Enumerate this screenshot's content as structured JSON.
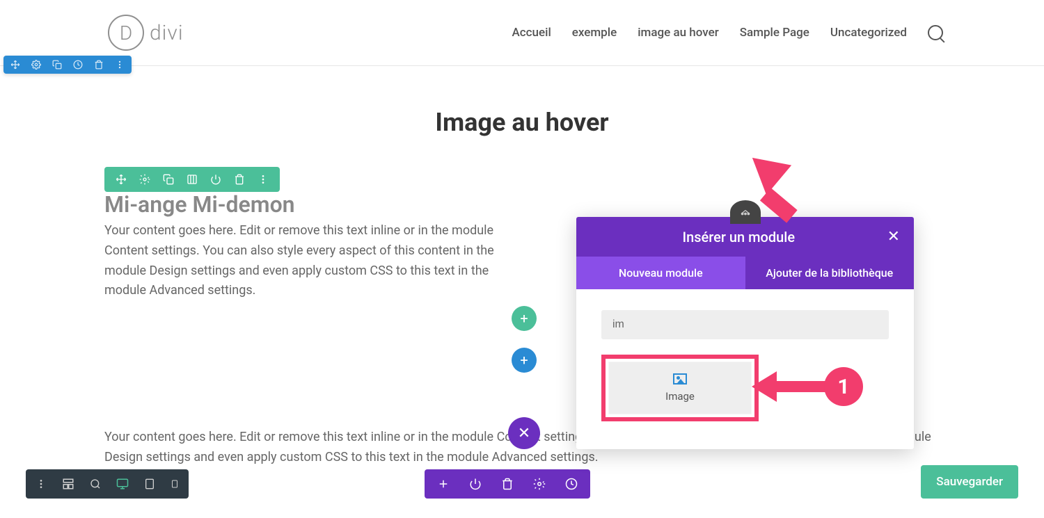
{
  "header": {
    "logo_text": "divi",
    "logo_letter": "D",
    "nav": [
      "Accueil",
      "exemple",
      "image au hover",
      "Sample Page",
      "Uncategorized"
    ]
  },
  "page": {
    "title": "Image au hover",
    "section_heading": "Mi-ange Mi-demon",
    "body1": "Your content goes here. Edit or remove this text inline or in the module Content settings. You can also style every aspect of this content in the module Design settings and even apply custom CSS to this text in the module Advanced settings.",
    "body2": "Your content goes here. Edit or remove this text inline or in the module Content settings. You can also style every aspect of this content in the module Design settings and even apply custom CSS to this text in the module Advanced settings."
  },
  "modal": {
    "title": "Insérer un module",
    "tabs": {
      "new": "Nouveau module",
      "library": "Ajouter de la bibliothèque"
    },
    "search_value": "im",
    "module_label": "Image"
  },
  "buttons": {
    "add": "+",
    "close": "✕",
    "save": "Sauvegarder"
  },
  "annotation": {
    "step1": "1"
  }
}
